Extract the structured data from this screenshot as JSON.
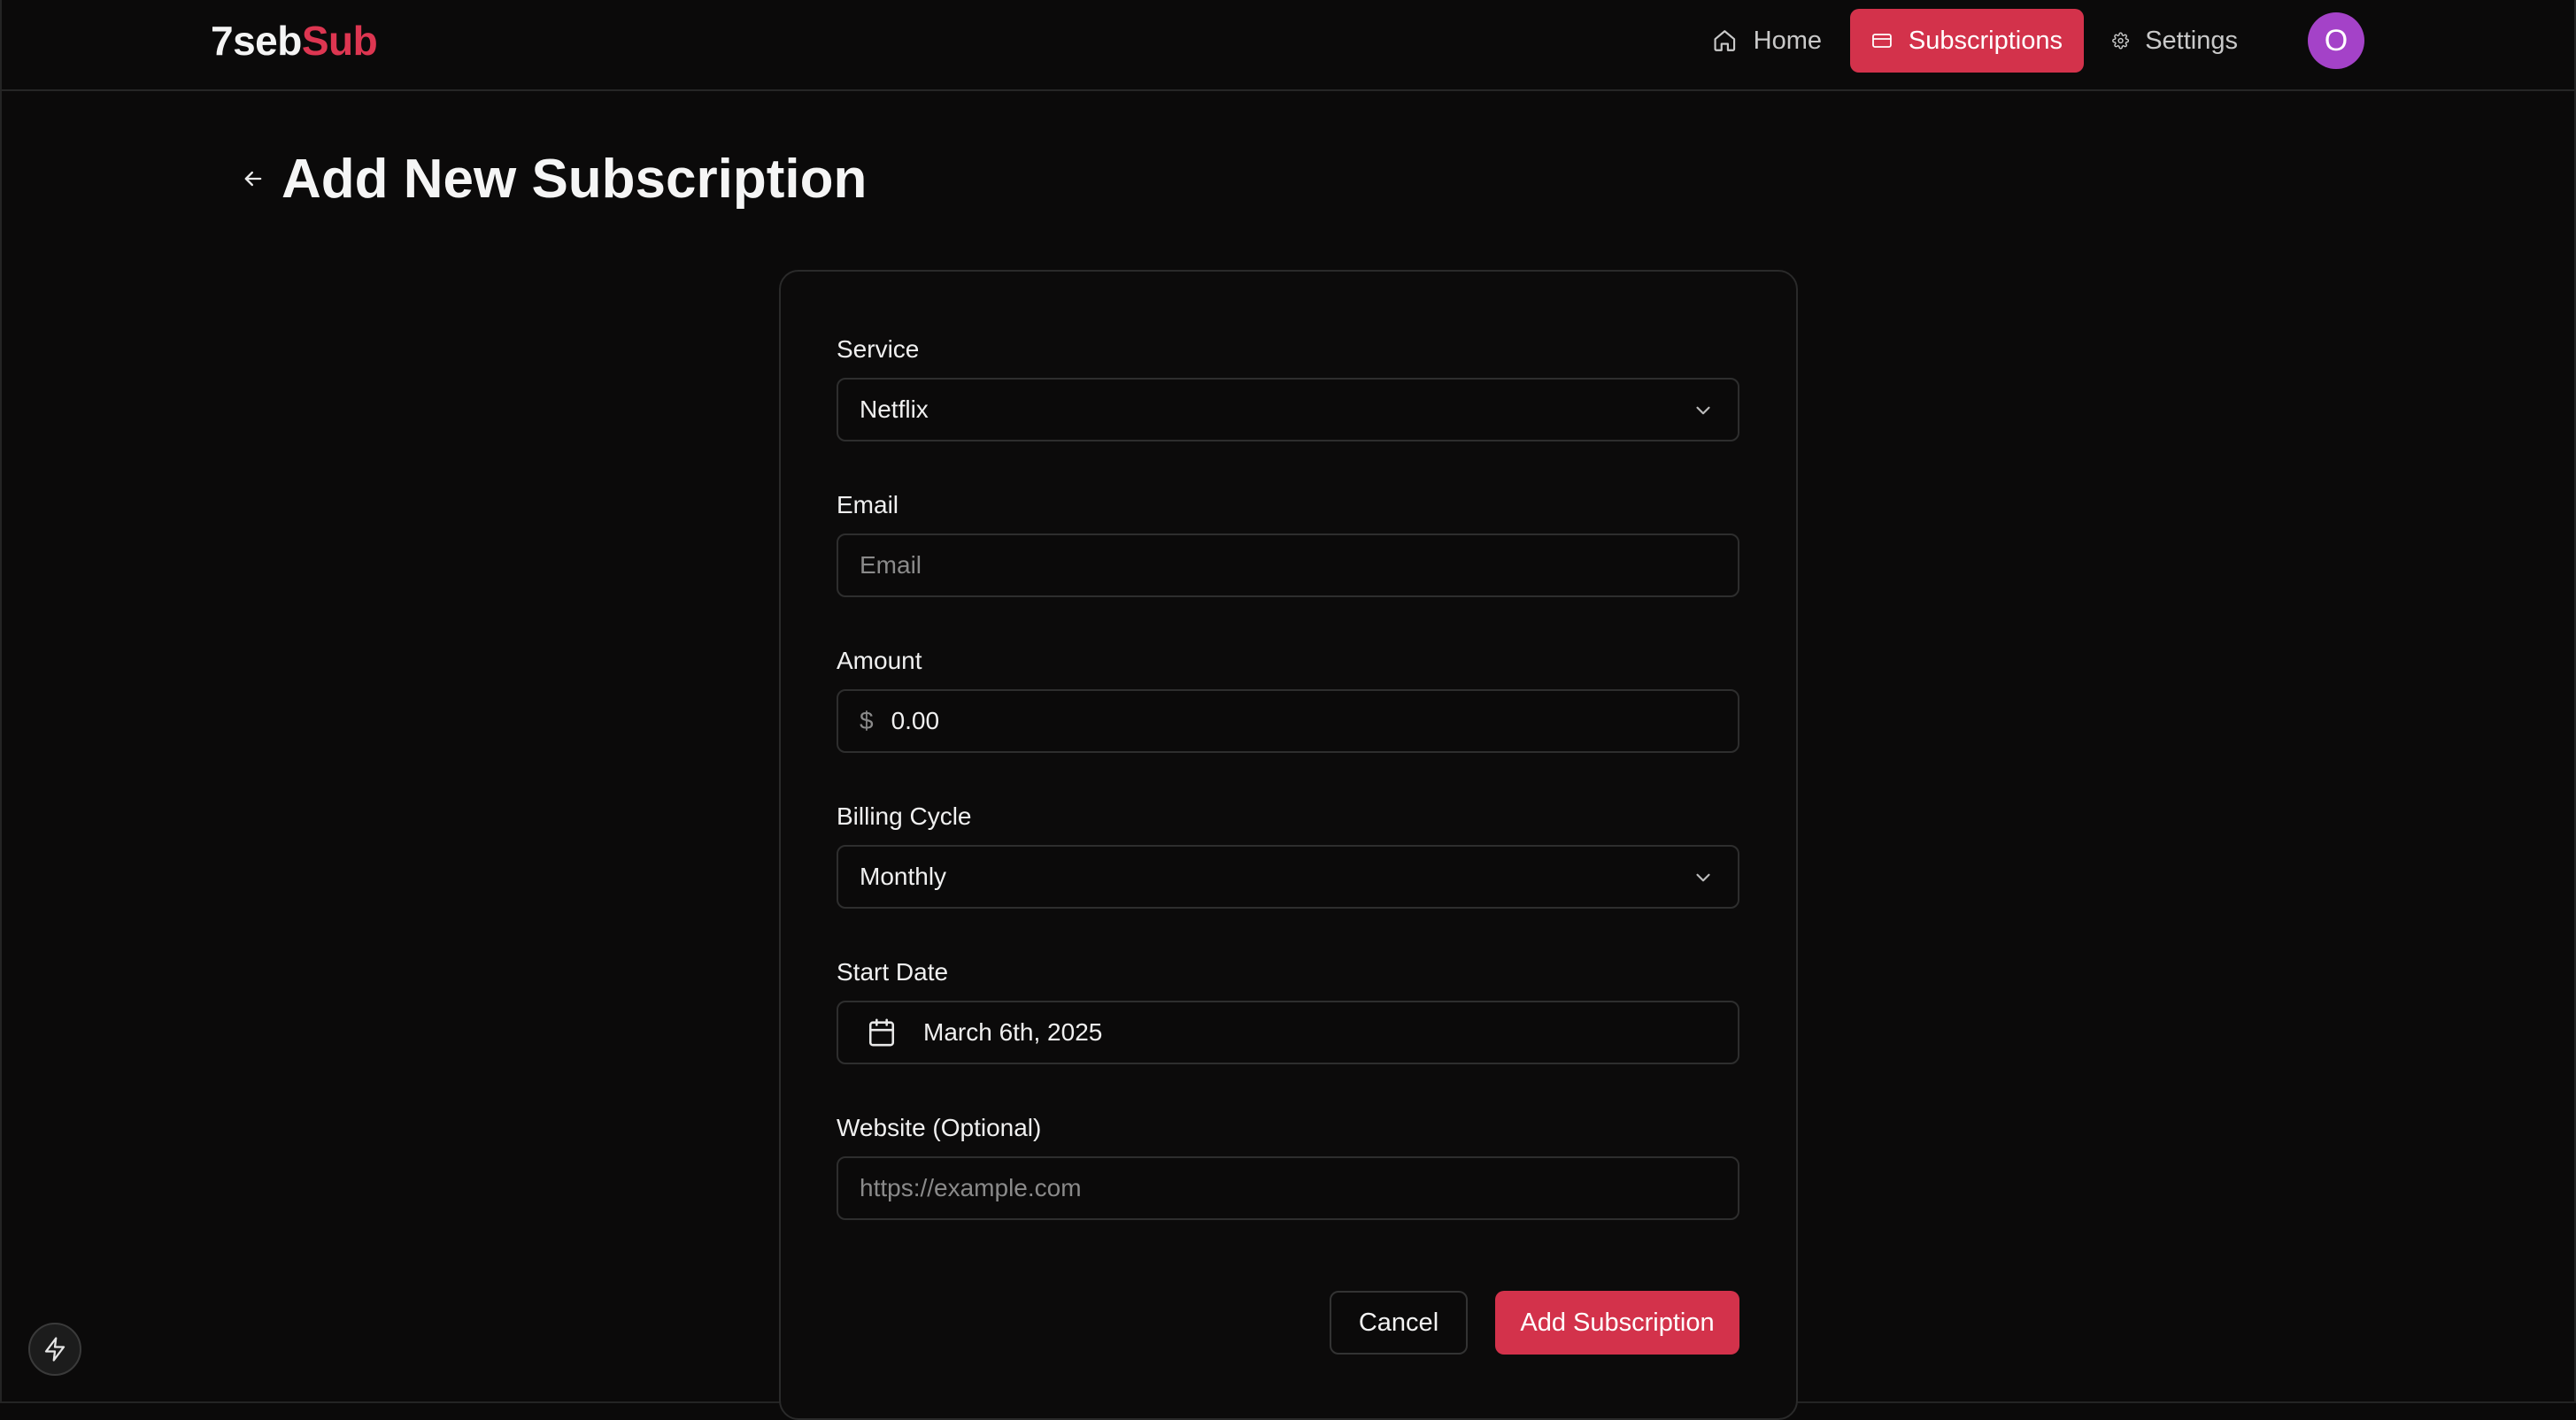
{
  "app": {
    "logo_part1": "7seb",
    "logo_part2": "Sub"
  },
  "nav": {
    "home": "Home",
    "subscriptions": "Subscriptions",
    "settings": "Settings",
    "avatar_initial": "O",
    "active": "Subscriptions"
  },
  "page": {
    "title": "Add New Subscription"
  },
  "form": {
    "service": {
      "label": "Service",
      "value": "Netflix"
    },
    "email": {
      "label": "Email",
      "placeholder": "Email"
    },
    "amount": {
      "label": "Amount",
      "currency": "$",
      "placeholder": "0.00"
    },
    "billing_cycle": {
      "label": "Billing Cycle",
      "value": "Monthly"
    },
    "start_date": {
      "label": "Start Date",
      "value": "March 6th, 2025"
    },
    "website": {
      "label": "Website (Optional)",
      "placeholder": "https://example.com"
    },
    "cancel_label": "Cancel",
    "submit_label": "Add Subscription"
  },
  "colors": {
    "accent": "#d3324b",
    "avatar": "#a442c8",
    "background": "#0b0a0a"
  }
}
